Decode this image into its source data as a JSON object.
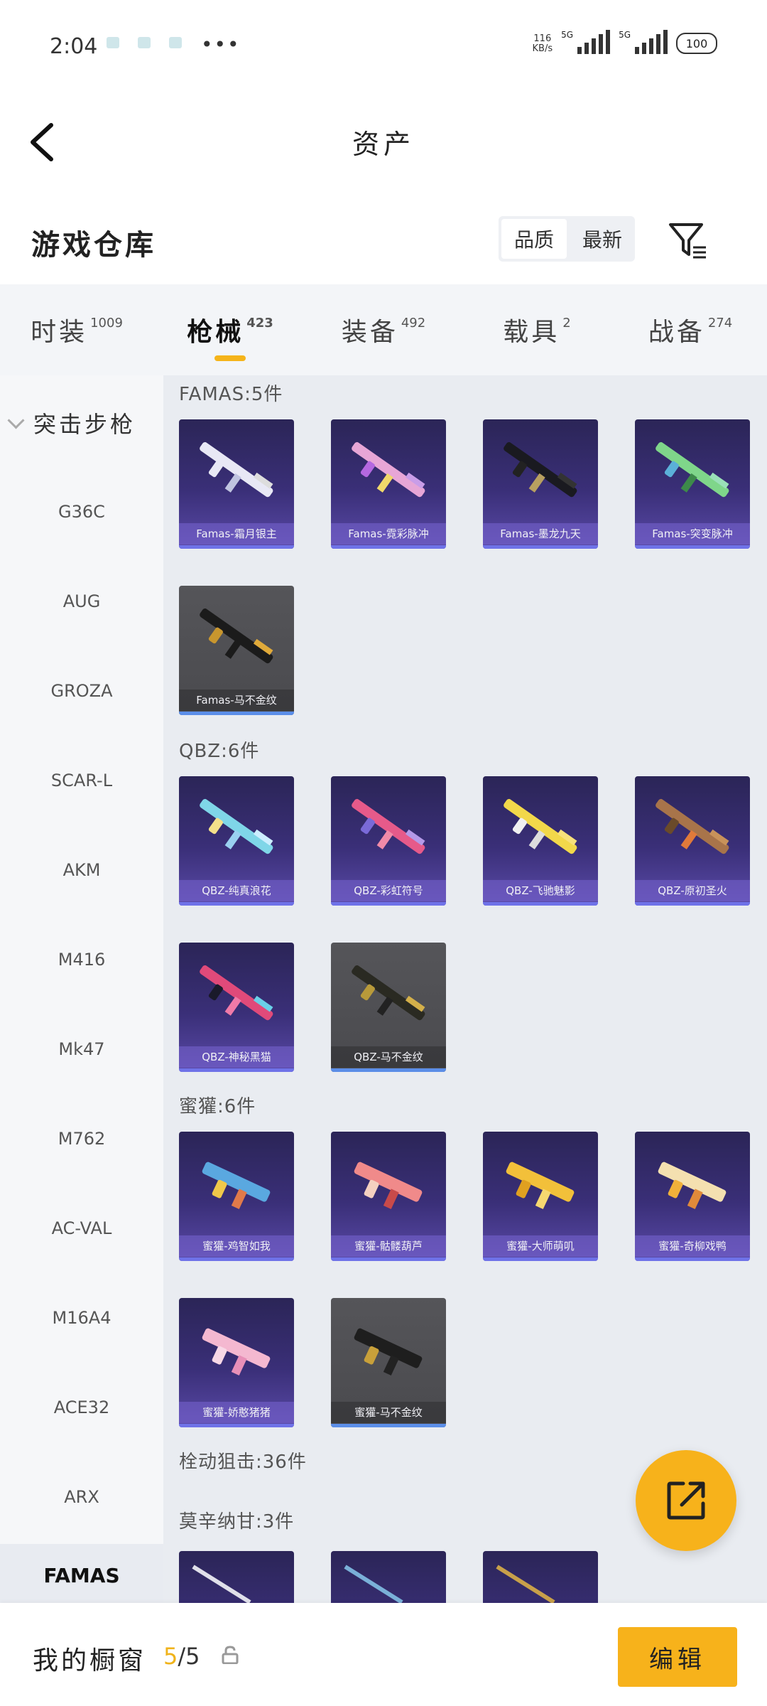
{
  "status": {
    "time": "2:04",
    "more": "•••",
    "speed_top": "116",
    "speed_bottom": "KB/s",
    "net1": "5G",
    "net2": "5G",
    "battery": "100"
  },
  "header": {
    "title": "资产"
  },
  "warehouse": {
    "title": "游戏仓库",
    "sort": [
      "品质",
      "最新"
    ]
  },
  "tabs": [
    {
      "label": "时装",
      "count": "1009"
    },
    {
      "label": "枪械",
      "count": "423"
    },
    {
      "label": "装备",
      "count": "492"
    },
    {
      "label": "载具",
      "count": "2"
    },
    {
      "label": "战备",
      "count": "274"
    }
  ],
  "sidebar": {
    "category": "突击步枪",
    "items": [
      "G36C",
      "AUG",
      "GROZA",
      "SCAR-L",
      "AKM",
      "M416",
      "Mk47",
      "M762",
      "AC-VAL",
      "M16A4",
      "ACE32",
      "ARX",
      "FAMAS"
    ]
  },
  "groups": [
    {
      "title": "FAMAS:5件",
      "items": [
        "Famas-霜月银主",
        "Famas-霓彩脉冲",
        "Famas-墨龙九天",
        "Famas-突变脉冲",
        "Famas-马不金纹"
      ]
    },
    {
      "title": "QBZ:6件",
      "items": [
        "QBZ-纯真浪花",
        "QBZ-彩虹符号",
        "QBZ-飞驰魅影",
        "QBZ-原初圣火",
        "QBZ-神秘黑猫",
        "QBZ-马不金纹"
      ]
    },
    {
      "title": "蜜獾:6件",
      "items": [
        "蜜獾-鸡智如我",
        "蜜獾-骷髅葫芦",
        "蜜獾-大师萌叽",
        "蜜獾-奇柳戏鸭",
        "蜜獾-娇憨猪猪",
        "蜜獾-马不金纹"
      ]
    },
    {
      "title": "栓动狙击:36件",
      "items": []
    },
    {
      "title": "莫辛纳甘:3件",
      "items": [
        "",
        "",
        ""
      ]
    }
  ],
  "bottom": {
    "label": "我的橱窗",
    "count_current": "5",
    "count_total": "/5",
    "edit": "编辑"
  },
  "colors": {
    "accent": "#f7b21b",
    "card_purple": "#3a2f78",
    "card_grey": "#4a4a4e"
  }
}
